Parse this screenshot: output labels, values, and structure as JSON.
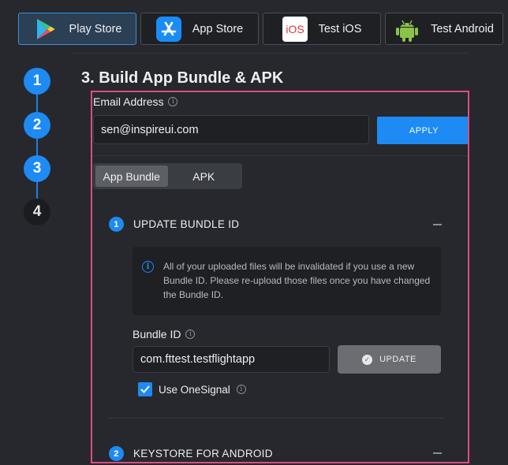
{
  "tabs": [
    {
      "label": "Play Store",
      "icon": "play-store-icon",
      "active": true
    },
    {
      "label": "App Store",
      "icon": "app-store-icon",
      "active": false
    },
    {
      "label": "Test iOS",
      "icon": "ios-icon",
      "active": false
    },
    {
      "label": "Test Android",
      "icon": "android-icon",
      "active": false
    }
  ],
  "ios_icon_text": "iOS",
  "steps": [
    "1",
    "2",
    "3",
    "4"
  ],
  "page_title": "3. Build App Bundle & APK",
  "email": {
    "label": "Email Address",
    "value": "sen@inspireui.com",
    "apply_label": "APPLY"
  },
  "build_type": {
    "options": [
      "App Bundle",
      "APK"
    ],
    "selected": "App Bundle"
  },
  "sections": [
    {
      "number": "1",
      "title": "UPDATE BUNDLE ID"
    },
    {
      "number": "2",
      "title": "KEYSTORE FOR ANDROID"
    }
  ],
  "notice": "All of your uploaded files will be invalidated if you use a new Bundle ID. Please re-upload those files once you have changed the Bundle ID.",
  "bundle": {
    "label": "Bundle ID",
    "value": "com.fttest.testflightapp",
    "update_label": "UPDATE"
  },
  "onesignal": {
    "label": "Use OneSignal",
    "checked": true
  },
  "colors": {
    "accent": "#1e8af3",
    "highlight_border": "#e14a82",
    "background": "#26282d"
  }
}
